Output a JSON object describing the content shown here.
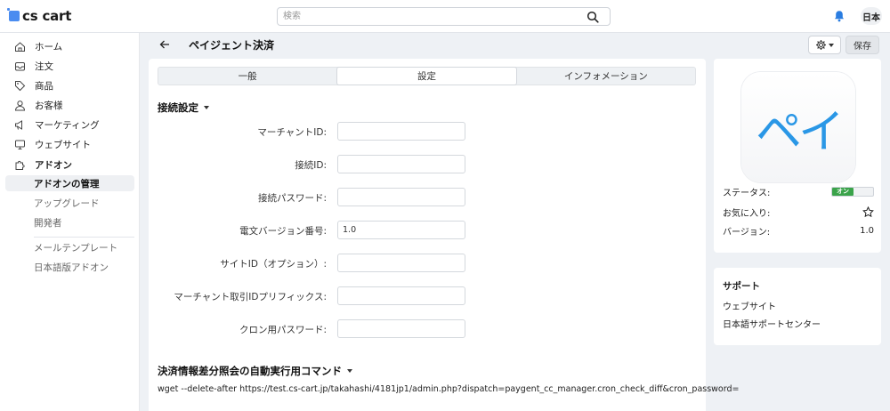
{
  "header": {
    "logo_text": "cs cart",
    "search_placeholder": "検索",
    "language_badge": "日本",
    "brand_color": "#4a8cf0"
  },
  "sidebar": {
    "items": [
      {
        "label": "ホーム",
        "icon": "home-icon"
      },
      {
        "label": "注文",
        "icon": "inbox-icon"
      },
      {
        "label": "商品",
        "icon": "tag-icon"
      },
      {
        "label": "お客様",
        "icon": "user-icon"
      },
      {
        "label": "マーケティング",
        "icon": "megaphone-icon"
      },
      {
        "label": "ウェブサイト",
        "icon": "monitor-icon"
      },
      {
        "label": "アドオン",
        "icon": "puzzle-icon"
      }
    ],
    "addon_sub": [
      "アドオンの管理",
      "アップグレード",
      "開発者"
    ],
    "extra_sub": [
      "メールテンプレート",
      "日本語版アドオン"
    ]
  },
  "page": {
    "title": "ペイジェント決済",
    "save_label": "保存"
  },
  "tabs": [
    "一般",
    "設定",
    "インフォメーション"
  ],
  "active_tab": 1,
  "section1": {
    "title": "接続設定",
    "fields": [
      {
        "label": "マーチャントID:",
        "value": ""
      },
      {
        "label": "接続ID:",
        "value": ""
      },
      {
        "label": "接続パスワード:",
        "value": ""
      },
      {
        "label": "電文バージョン番号:",
        "value": "1.0"
      },
      {
        "label": "サイトID（オプション）:",
        "value": ""
      },
      {
        "label": "マーチャント取引IDプリフィックス:",
        "value": ""
      },
      {
        "label": "クロン用パスワード:",
        "value": ""
      }
    ]
  },
  "section2": {
    "title": "決済情報差分照会の自動実行用コマンド",
    "command": "wget --delete-after https://test.cs-cart.jp/takahashi/4181jp1/admin.php?dispatch=paygent_cc_manager.cron_check_diff&cron_password="
  },
  "addon_info": {
    "logo_text": "ペイ",
    "status_label": "ステータス:",
    "status_on": "オン",
    "favorite_label": "お気に入り:",
    "version_label": "バージョン:",
    "version_value": "1.0",
    "status_color": "#3aa34a",
    "logo_color": "#2a97e6"
  },
  "support": {
    "title": "サポート",
    "links": [
      "ウェブサイト",
      "日本語サポートセンター"
    ]
  }
}
